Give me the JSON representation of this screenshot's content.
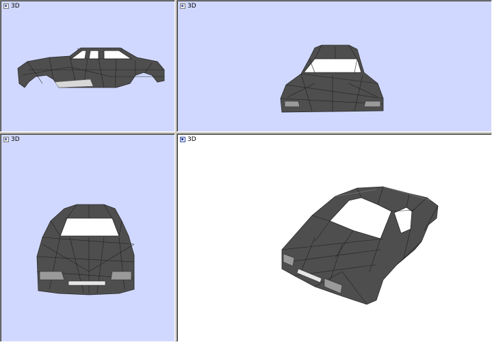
{
  "viewports": [
    {
      "id": "side",
      "label": "3D",
      "background": "#d0d8ff",
      "active": false
    },
    {
      "id": "top-front",
      "label": "3D",
      "background": "#d0d8ff",
      "active": false
    },
    {
      "id": "front",
      "label": "3D",
      "background": "#d0d8ff",
      "active": false
    },
    {
      "id": "perspective",
      "label": "3D",
      "background": "#ffffff",
      "active": true
    }
  ],
  "icons": {
    "viewport_menu": "viewport-menu-icon"
  },
  "colors": {
    "mesh": "#4e4e4e",
    "frame": "#d4d0c8"
  }
}
